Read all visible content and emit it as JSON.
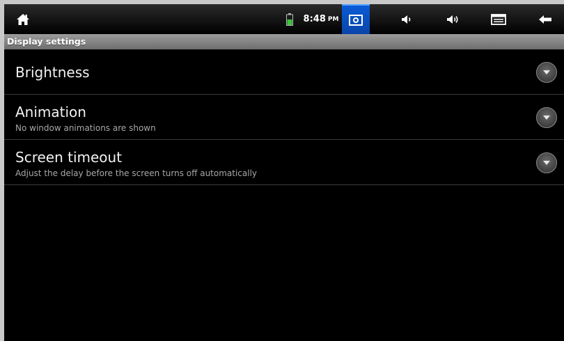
{
  "status_bar": {
    "icons": [
      "home-icon",
      "battery-icon",
      "screenshot-icon",
      "volume-down-icon",
      "volume-up-icon",
      "menu-icon",
      "back-icon"
    ],
    "time": "8:48",
    "ampm": "PM",
    "battery_color": "#3cc43c",
    "screenshot_color": "#0a5bd6"
  },
  "header": {
    "title": "Display settings"
  },
  "settings": {
    "items": [
      {
        "title": "Brightness",
        "summary": ""
      },
      {
        "title": "Animation",
        "summary": "No window animations are shown"
      },
      {
        "title": "Screen timeout",
        "summary": "Adjust the delay before the screen turns off automatically"
      }
    ]
  }
}
